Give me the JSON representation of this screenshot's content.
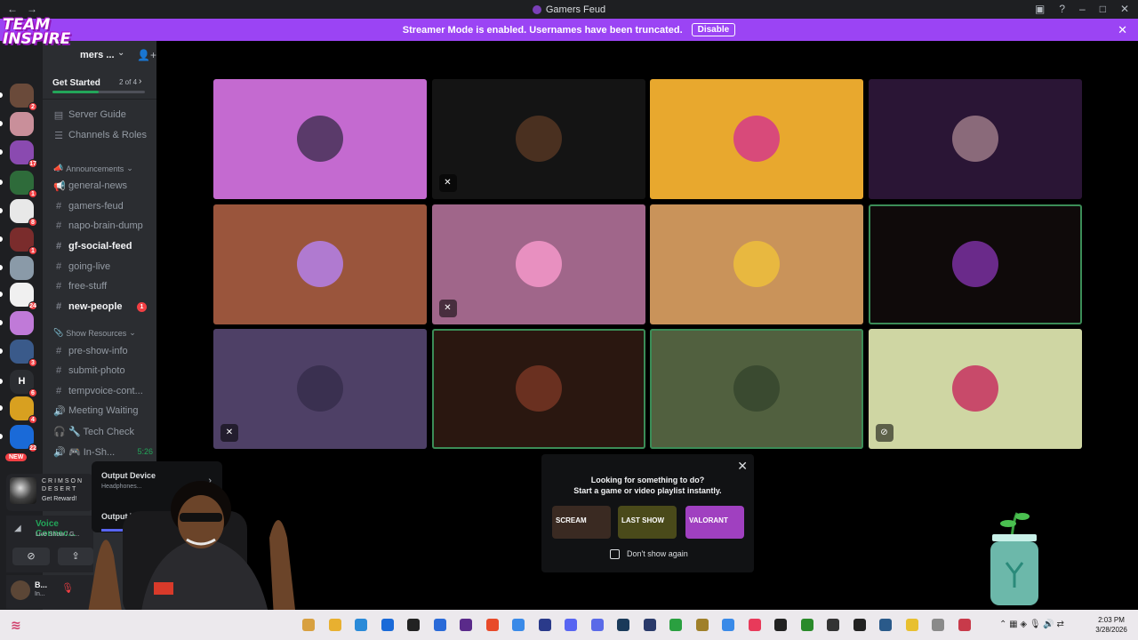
{
  "window": {
    "title": "Gamers Feud",
    "back": "←",
    "forward": "→",
    "controls": [
      "inbox-icon",
      "help-icon",
      "minimize-icon",
      "maximize-icon",
      "close-icon"
    ]
  },
  "banner": {
    "text": "Streamer Mode is enabled. Usernames have been truncated.",
    "button": "Disable",
    "close": "✕",
    "color": "#9b44f4"
  },
  "overlay_logo": {
    "line1": "TEAM",
    "line2": "INSPIRE"
  },
  "server_header": {
    "name": "mers ...",
    "chevron": "⌄"
  },
  "get_started": {
    "label": "Get Started",
    "progress_text": "2 of 4",
    "progress": 0.5
  },
  "servers": [
    {
      "badge": "2",
      "color": "#6a4a3a"
    },
    {
      "badge": "",
      "color": "#c98f9a"
    },
    {
      "badge": "17",
      "color": "#8a4ab0"
    },
    {
      "badge": "1",
      "color": "#2e6b3a"
    },
    {
      "badge": "8",
      "color": "#e8e8e8"
    },
    {
      "badge": "1",
      "color": "#7a2c2c"
    },
    {
      "badge": "",
      "color": "#8a9aa8"
    },
    {
      "badge": "24",
      "color": "#f0f0f0"
    },
    {
      "badge": "",
      "color": "#c07ad8"
    },
    {
      "badge": "3",
      "color": "#3a5a8a"
    },
    {
      "badge": "6",
      "color": "#2b2d31",
      "letter": "H"
    },
    {
      "badge": "4",
      "color": "#d8a020"
    },
    {
      "badge": "22",
      "color": "#1a6ad8"
    }
  ],
  "new_badge": "NEW",
  "channels": {
    "top": [
      {
        "name": "Server Guide",
        "icon": "▤"
      },
      {
        "name": "Channels & Roles",
        "icon": "☰"
      }
    ],
    "announcements": {
      "label": "Announcements",
      "emoji": "📣",
      "items": [
        {
          "name": "general-news",
          "icon": "📢",
          "bold": false
        },
        {
          "name": "gamers-feud",
          "icon": "#",
          "bold": false
        },
        {
          "name": "napo-brain-dump",
          "icon": "#",
          "bold": false
        },
        {
          "name": "gf-social-feed",
          "icon": "#",
          "bold": true
        },
        {
          "name": "going-live",
          "icon": "#",
          "bold": false
        },
        {
          "name": "free-stuff",
          "icon": "#",
          "bold": false
        },
        {
          "name": "new-people",
          "icon": "#",
          "bold": true,
          "unread": "1"
        }
      ]
    },
    "show_resources": {
      "label": "Show Resources",
      "emoji": "📎",
      "items": [
        {
          "name": "pre-show-info",
          "icon": "#"
        },
        {
          "name": "submit-photo",
          "icon": "#"
        },
        {
          "name": "tempvoice-cont...",
          "icon": "#"
        },
        {
          "name": "Meeting Waiting",
          "icon": "🔊"
        },
        {
          "name": "🔧 Tech Check",
          "icon": "🎧"
        },
        {
          "name": "🎮 In-Sh...",
          "icon": "🔊",
          "timer": "5:26"
        }
      ]
    }
  },
  "promo": {
    "title": "CRIMSON DESERT",
    "cta": "Get Reward!"
  },
  "voice": {
    "status": "Voice Connec...",
    "detail": "Live Show / G..."
  },
  "user": {
    "name": "B...",
    "status": "In..."
  },
  "output_popover": {
    "device_label": "Output Device",
    "device_value": "Headphones...",
    "volume_label": "Output V..."
  },
  "tiles": [
    {
      "bg": "#c46ad0",
      "av": "#5a3a6a",
      "muted": false,
      "speaking": false
    },
    {
      "bg": "#141414",
      "av": "#4a3020",
      "muted": true,
      "speaking": false
    },
    {
      "bg": "#e8a82e",
      "av": "#d84a7a",
      "muted": false,
      "speaking": false
    },
    {
      "bg": "#2a1535",
      "av": "#8a6a7a",
      "muted": false,
      "speaking": false
    },
    {
      "bg": "#9a553c",
      "av": "#b07ad0",
      "muted": false,
      "speaking": false
    },
    {
      "bg": "#a0668a",
      "av": "#e890c0",
      "muted": true,
      "speaking": false
    },
    {
      "bg": "#c9935a",
      "av": "#e8b840",
      "muted": false,
      "speaking": false
    },
    {
      "bg": "#0f0a0a",
      "av": "#6a2a8a",
      "muted": false,
      "speaking": true
    },
    {
      "bg": "#4e4066",
      "av": "#3a3050",
      "muted": true,
      "speaking": false
    },
    {
      "bg": "#2a1710",
      "av": "#6a3020",
      "muted": false,
      "speaking": true
    },
    {
      "bg": "#51603f",
      "av": "#3a4a30",
      "muted": false,
      "speaking": true
    },
    {
      "bg": "#cfd6a3",
      "av": "#c84a6a",
      "muted": false,
      "videoOff": true,
      "speaking": false
    }
  ],
  "activity": {
    "line1": "Looking for something to do?",
    "line2": "Start a game or video playlist instantly.",
    "games": [
      {
        "label": "SCREAM",
        "color": "#3a2a22"
      },
      {
        "label": "LAST SHOW",
        "color": "#4a4a1a"
      },
      {
        "label": "VALORANT",
        "color": "#a040c0"
      }
    ],
    "dont_show": "Don't show again"
  },
  "taskbar": {
    "apps": [
      "#d8a040",
      "#e8b030",
      "#2a8ad8",
      "#1a6ad8",
      "#222222",
      "#2a6ad8",
      "#5a2a8a",
      "#e84a2a",
      "#3a8ae8",
      "#2a3a8a",
      "#5865f2",
      "#5a6ae8",
      "#1a3a5a",
      "#2a3a6a",
      "#2aa040",
      "#a0802a",
      "#3a8ae8",
      "#e83a5a",
      "#222222",
      "#2a8a2a",
      "#333333",
      "#222222",
      "#2a5a8a",
      "#e8c030",
      "#8a8a8a",
      "#c83a4a"
    ],
    "time": "2:03 PM",
    "date": "3/28/2026"
  }
}
